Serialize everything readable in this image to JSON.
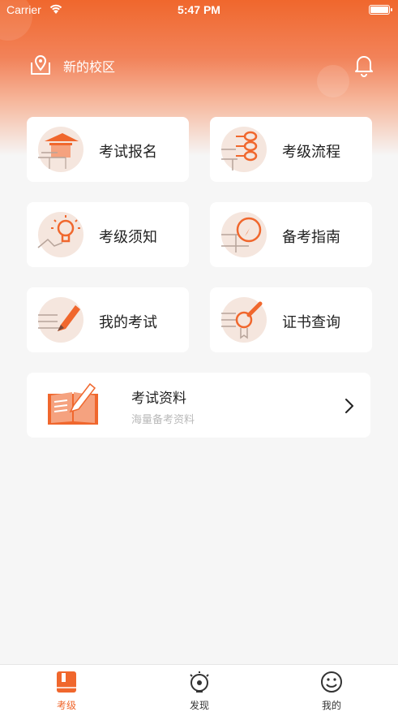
{
  "status_bar": {
    "carrier": "Carrier",
    "time": "5:47 PM"
  },
  "header": {
    "campus": "新的校区",
    "location_icon": "map-pin-icon",
    "bell_icon": "bell-icon"
  },
  "menu": [
    {
      "label": "考试报名",
      "icon": "registration-icon"
    },
    {
      "label": "考级流程",
      "icon": "process-icon"
    },
    {
      "label": "考级须知",
      "icon": "lightbulb-icon"
    },
    {
      "label": "备考指南",
      "icon": "compass-icon"
    },
    {
      "label": "我的考试",
      "icon": "pencil-icon"
    },
    {
      "label": "证书查询",
      "icon": "certificate-search-icon"
    }
  ],
  "resource": {
    "title": "考试资料",
    "subtitle": "海量备考资料",
    "icon": "open-book-icon"
  },
  "tabs": [
    {
      "label": "考级",
      "icon": "book-icon",
      "active": true
    },
    {
      "label": "发现",
      "icon": "discover-icon",
      "active": false
    },
    {
      "label": "我的",
      "icon": "smiley-icon",
      "active": false
    }
  ],
  "colors": {
    "accent": "#f0672d",
    "icon_bg": "#f5e6de",
    "background": "#f6f6f6"
  }
}
